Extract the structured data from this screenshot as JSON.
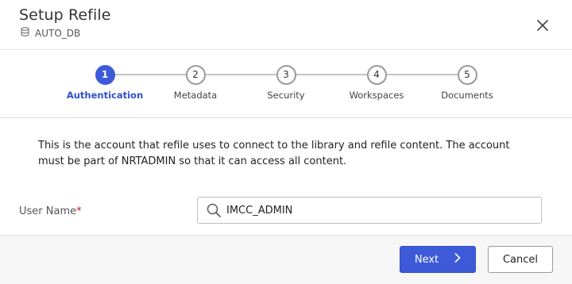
{
  "dialog": {
    "title": "Setup Refile",
    "subtitle_icon": "database-icon",
    "subtitle": "AUTO_DB",
    "close_icon": "close-icon"
  },
  "stepper": {
    "active_index": 0,
    "steps": [
      {
        "number": "1",
        "label": "Authentication"
      },
      {
        "number": "2",
        "label": "Metadata"
      },
      {
        "number": "3",
        "label": "Security"
      },
      {
        "number": "4",
        "label": "Workspaces"
      },
      {
        "number": "5",
        "label": "Documents"
      }
    ]
  },
  "content": {
    "description": "This is the account that refile uses to connect to the library and refile content. The account must be part of NRTADMIN so that it can access all content.",
    "user_name_label": "User Name",
    "required_marker": "*",
    "user_name_value": "IMCC_ADMIN",
    "search_icon": "search-icon"
  },
  "footer": {
    "next_label": "Next",
    "next_icon": "chevron-right-icon",
    "cancel_label": "Cancel"
  },
  "colors": {
    "accent": "#3d5bd9",
    "required": "#c9202a"
  }
}
